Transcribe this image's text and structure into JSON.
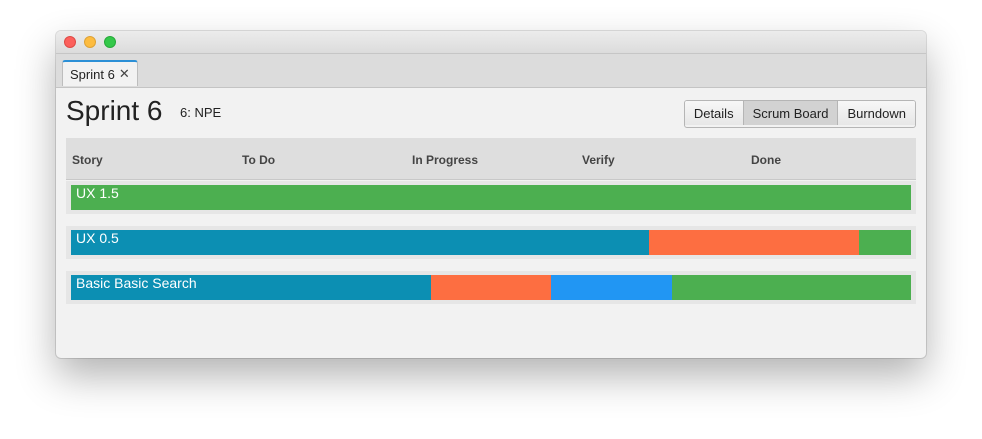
{
  "window": {
    "tabs": [
      {
        "label": "Sprint 6",
        "close": "✕"
      }
    ]
  },
  "header": {
    "title": "Sprint 6",
    "subtitle": "6: NPE",
    "view_buttons": [
      {
        "label": "Details",
        "active": false
      },
      {
        "label": "Scrum Board",
        "active": true
      },
      {
        "label": "Burndown",
        "active": false
      }
    ]
  },
  "board": {
    "columns": [
      "Story",
      "To Do",
      "In Progress",
      "Verify",
      "Done"
    ],
    "colors": {
      "to_do": "#0c8fb3",
      "in_progress": "#fd6e41",
      "verify": "#2196f3",
      "done": "#4caf50"
    },
    "stories": [
      {
        "name": "UX 1.5",
        "to_do": 0,
        "in_progress": 0,
        "verify": 0,
        "done": 100
      },
      {
        "name": "UX 0.5",
        "to_do": 68.8,
        "in_progress": 25.0,
        "verify": 0,
        "done": 6.2
      },
      {
        "name": "Basic Basic Search",
        "to_do": 42.9,
        "in_progress": 14.3,
        "verify": 14.3,
        "done": 28.5
      }
    ]
  }
}
